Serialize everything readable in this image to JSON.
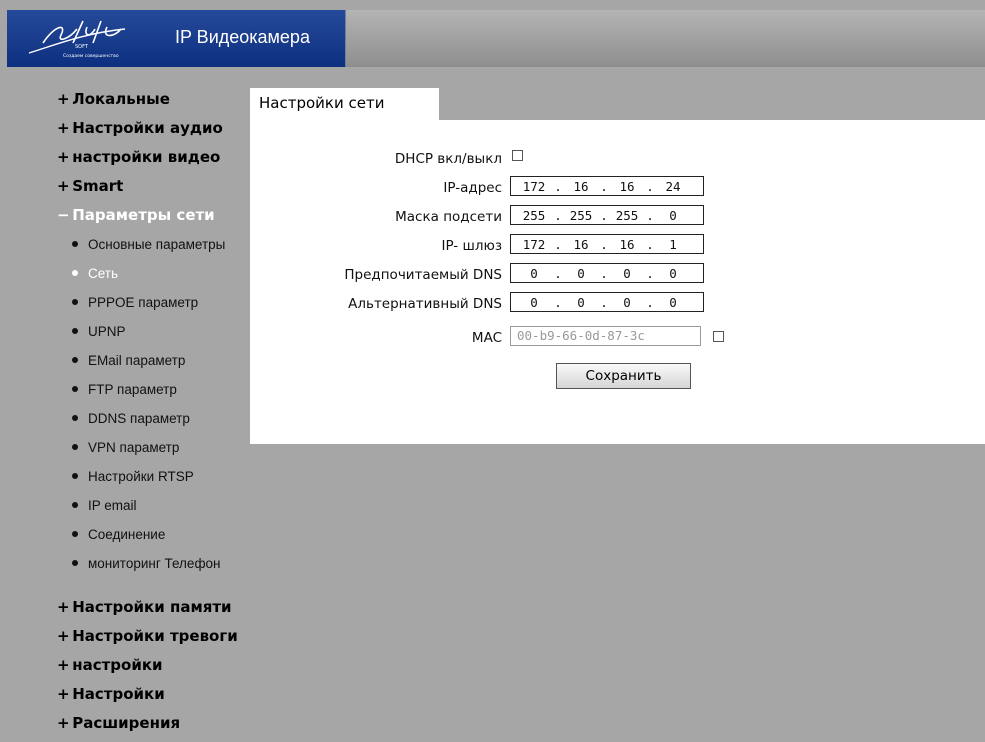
{
  "header": {
    "app_title": "IP Видеокамера",
    "logo_text": "Stil",
    "logo_subtext": "SOFT",
    "logo_slogan": "Создаем совершенство"
  },
  "sidebar": {
    "groups_top": [
      {
        "sign": "+",
        "label": "Локальные"
      },
      {
        "sign": "+",
        "label": "Настройки аудио"
      },
      {
        "sign": "+",
        "label": "настройки видео"
      },
      {
        "sign": "+",
        "label": "Smart"
      },
      {
        "sign": "−",
        "label": "Параметры сети",
        "active": true
      }
    ],
    "items": [
      "Основные параметры",
      "Сеть",
      "PPPOE параметр",
      "UPNP",
      "EMail параметр",
      "FTP параметр",
      "DDNS параметр",
      "VPN параметр",
      "Настройки RTSP",
      "IP email",
      "Соединение",
      "мониторинг Телефон"
    ],
    "active_item_index": 1,
    "groups_bottom": [
      {
        "sign": "+",
        "label": "Настройки памяти"
      },
      {
        "sign": "+",
        "label": "Настройки тревоги"
      },
      {
        "sign": "+",
        "label": "настройки"
      },
      {
        "sign": "+",
        "label": "Настройки"
      },
      {
        "sign": "+",
        "label": "Расширения"
      }
    ]
  },
  "panel": {
    "tab_label": "Настройки сети",
    "dhcp": {
      "label": "DHCP вкл/выкл",
      "checked": false
    },
    "ip_address": {
      "label": "IP-адрес",
      "octets": [
        "172",
        "16",
        "16",
        "24"
      ]
    },
    "subnet_mask": {
      "label": "Маска подсети",
      "octets": [
        "255",
        "255",
        "255",
        "0"
      ]
    },
    "gateway": {
      "label": "IP- шлюз",
      "octets": [
        "172",
        "16",
        "16",
        "1"
      ]
    },
    "preferred_dns": {
      "label": "Предпочитаемый DNS",
      "octets": [
        "0",
        "0",
        "0",
        "0"
      ]
    },
    "alternate_dns": {
      "label": "Альтернативный DNS",
      "octets": [
        "0",
        "0",
        "0",
        "0"
      ]
    },
    "mac": {
      "label": "MAC",
      "value": "00-b9-66-0d-87-3c",
      "checked": false
    },
    "save_label": "Сохранить"
  },
  "colors": {
    "background": "#a6a6a6",
    "logo_blue": "#1a3d8f",
    "active_text": "#ffffff",
    "panel": "#ffffff"
  }
}
